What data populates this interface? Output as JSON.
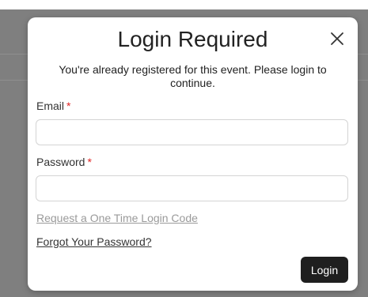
{
  "modal": {
    "title": "Login Required",
    "close_icon": "close-icon",
    "description": "You're already registered for this event. Please login to continue."
  },
  "form": {
    "email_label": "Email",
    "password_label": "Password",
    "required_marker": "*",
    "email_value": "",
    "password_value": "",
    "otp_link": "Request a One Time Login Code",
    "forgot_link": "Forgot Your Password?",
    "submit_label": "Login"
  },
  "colors": {
    "backdrop": "#7f7f7f",
    "required": "#e02424",
    "button_bg": "#1f1f1f",
    "muted_link": "#9a9a9a"
  }
}
